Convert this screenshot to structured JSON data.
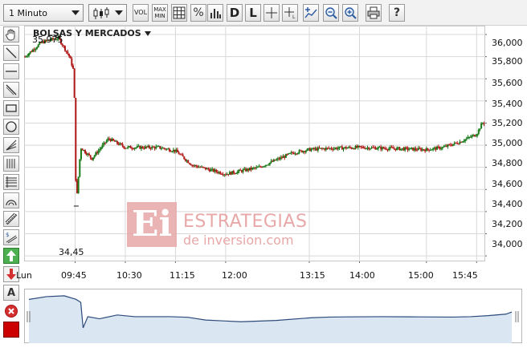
{
  "toolbar": {
    "interval_value": "1 Minuto",
    "chart_type_icon": "candlestick-icon",
    "vol_label": "VOL",
    "maxmin_top": "MAX",
    "maxmin_bottom": "MIN",
    "grid_icon": "grid-icon",
    "percent_label": "%",
    "d_label": "D",
    "l_label": "L",
    "crosshair_icon": "crosshair-icon",
    "crosshair_level_icon": "crosshair-level-icon",
    "add_indicator_icon": "add-indicator-icon",
    "zoom_out_icon": "zoom-out-icon",
    "zoom_in_icon": "zoom-in-icon",
    "print_icon": "print-icon",
    "help_label": "?"
  },
  "left_tools": [
    {
      "name": "hand-pan-icon"
    },
    {
      "name": "trend-line-icon"
    },
    {
      "name": "horizontal-line-icon"
    },
    {
      "name": "parallel-line-icon"
    },
    {
      "name": "rectangle-icon"
    },
    {
      "name": "circle-icon"
    },
    {
      "name": "fan-icon"
    },
    {
      "name": "vertical-lines-icon"
    },
    {
      "name": "fibonacci-icon"
    },
    {
      "name": "arc-icon"
    },
    {
      "name": "channel-icon"
    },
    {
      "name": "dollar-lines-icon"
    },
    {
      "name": "buy-arrow-icon"
    },
    {
      "name": "sell-arrow-icon"
    },
    {
      "name": "text-tool-icon",
      "label": "A"
    },
    {
      "name": "delete-all-icon"
    },
    {
      "name": "color-swatch-icon"
    }
  ],
  "chart": {
    "title": "BOLSAS Y MERCADOS",
    "high_annotation": "35,975",
    "low_annotation": "34,45",
    "y_ticks": [
      "36,000",
      "35,800",
      "35,600",
      "35,400",
      "35,200",
      "35,000",
      "34,800",
      "34,600",
      "34,400",
      "34,200",
      "34,000"
    ],
    "x_ticks": [
      "Lun",
      "09:45",
      "10:30",
      "11:15",
      "12:00",
      "13:15",
      "14:00",
      "15:00",
      "15:45"
    ]
  },
  "watermark": {
    "logo": "Ei",
    "line1": "ESTRATEGIAS",
    "line2": "de inversion.com"
  },
  "colors": {
    "up_candle": "#1a7a1a",
    "down_candle": "#b21a1a",
    "grid": "#d8d8d8",
    "navigator_line": "#2b4a7a",
    "navigator_fill": "#dbe6f3",
    "watermark": "#e8a8a8"
  },
  "chart_data": {
    "type": "line",
    "title": "BOLSAS Y MERCADOS",
    "x": [
      "09:00",
      "09:15",
      "09:30",
      "09:40",
      "09:44",
      "09:46",
      "09:50",
      "10:00",
      "10:15",
      "10:30",
      "11:00",
      "11:15",
      "11:30",
      "11:45",
      "12:00",
      "12:30",
      "13:00",
      "13:15",
      "13:30",
      "14:00",
      "14:30",
      "15:00",
      "15:15",
      "15:30",
      "15:45",
      "15:50"
    ],
    "series": [
      {
        "values": [
          35.8,
          35.93,
          35.97,
          35.8,
          35.66,
          34.45,
          34.98,
          34.88,
          35.06,
          34.98,
          34.98,
          34.95,
          34.82,
          34.78,
          34.74,
          34.8,
          34.93,
          34.96,
          34.97,
          34.98,
          34.97,
          34.96,
          34.98,
          35.03,
          35.1,
          35.2
        ]
      }
    ],
    "ylim": [
      33.95,
      36.08
    ],
    "xlabel": "",
    "ylabel": "",
    "grid": true,
    "annotations": [
      {
        "label": "35,975",
        "x": "09:30",
        "y": 35.975
      },
      {
        "label": "34,45",
        "x": "09:46",
        "y": 34.45
      }
    ]
  }
}
